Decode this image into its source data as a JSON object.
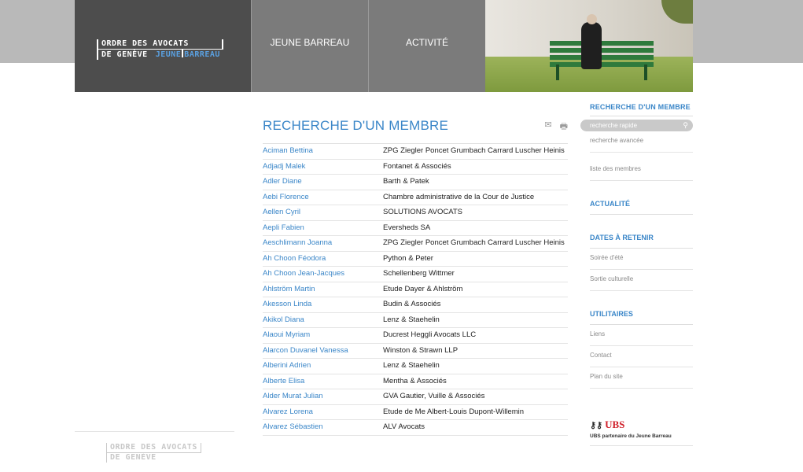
{
  "header": {
    "logo_line1": "ORDRE DES AVOCATS",
    "logo_line2": "DE GENÈVE",
    "logo_jb_part1": "JEUNE",
    "logo_jb_part2": "BARREAU",
    "nav": [
      {
        "label": "JEUNE BARREAU"
      },
      {
        "label": "ACTIVITÉ"
      }
    ]
  },
  "main": {
    "title": "RECHERCHE D'UN MEMBRE",
    "tools": {
      "email_icon": "envelope-icon",
      "print_icon": "printer-icon"
    },
    "members": [
      {
        "name": "Aciman Bettina",
        "firm": "ZPG Ziegler Poncet Grumbach Carrard Luscher Heinis"
      },
      {
        "name": "Adjadj Malek",
        "firm": "Fontanet & Associés"
      },
      {
        "name": "Adler Diane",
        "firm": "Barth & Patek"
      },
      {
        "name": "Aebi Florence",
        "firm": "Chambre administrative de la Cour de Justice"
      },
      {
        "name": "Aellen Cyril",
        "firm": "SOLUTIONS AVOCATS"
      },
      {
        "name": "Aepli Fabien",
        "firm": "Eversheds SA"
      },
      {
        "name": "Aeschlimann Joanna",
        "firm": "ZPG Ziegler Poncet Grumbach Carrard Luscher Heinis"
      },
      {
        "name": "Ah Choon Féodora",
        "firm": "Python & Peter"
      },
      {
        "name": "Ah Choon Jean-Jacques",
        "firm": "Schellenberg Wittmer"
      },
      {
        "name": "Ahlström Martin",
        "firm": "Etude Dayer & Ahlström"
      },
      {
        "name": "Akesson Linda",
        "firm": "Budin & Associés"
      },
      {
        "name": "Akikol Diana",
        "firm": "Lenz & Staehelin"
      },
      {
        "name": "Alaoui Myriam",
        "firm": "Ducrest Heggli Avocats LLC"
      },
      {
        "name": "Alarcon Duvanel Vanessa",
        "firm": "Winston & Strawn LLP"
      },
      {
        "name": "Alberini Adrien",
        "firm": "Lenz & Staehelin"
      },
      {
        "name": "Alberte Elisa",
        "firm": "Mentha & Associés"
      },
      {
        "name": "Alder Murat Julian",
        "firm": "GVA Gautier, Vuille & Associés"
      },
      {
        "name": "Alvarez Lorena",
        "firm": "Etude de Me Albert-Louis Dupont-Willemin"
      },
      {
        "name": "Alvarez Sébastien",
        "firm": "ALV Avocats"
      }
    ]
  },
  "sidebar": {
    "search_title": "RECHERCHE D'UN MEMBRE",
    "search_placeholder": "recherche rapide",
    "advanced_search": "recherche avancée",
    "member_list": "liste des membres",
    "news": "ACTUALITÉ",
    "dates_title": "DATES À RETENIR",
    "dates": [
      "Soirée d'été",
      "Sortie culturelle"
    ],
    "utilities_title": "UTILITAIRES",
    "utilities": [
      "Liens",
      "Contact",
      "Plan du site"
    ],
    "sponsor_brand": "UBS",
    "sponsor_caption": "UBS partenaire du Jeune Barreau"
  },
  "footer": {
    "logo_line1": "ORDRE DES AVOCATS",
    "logo_line2": "DE GENÈVE"
  },
  "colors": {
    "accent": "#3a86c8",
    "header_dark": "#4d4d4d",
    "nav_gray": "#7b7b7b",
    "ubs_red": "#d0202a"
  }
}
